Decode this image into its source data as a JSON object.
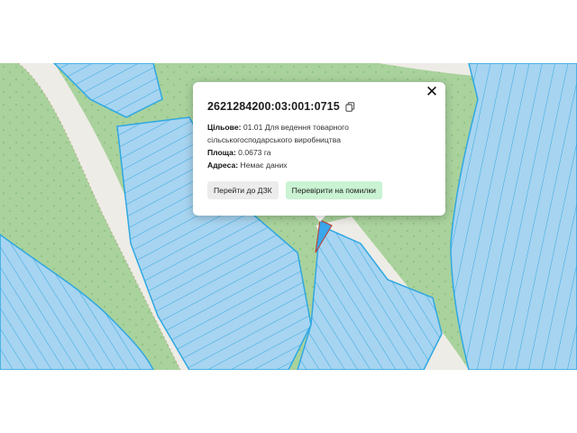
{
  "popup": {
    "parcel_number": "2621284200:03:001:0715",
    "purpose_label": "Цільове:",
    "purpose_value": "01.01 Для ведення товарного сільськогосподарського виробництва",
    "area_label": "Площа:",
    "area_value": "0.0673 га",
    "address_label": "Адреса:",
    "address_value": "Немає даних",
    "goto_button": "Перейти до ДЗК",
    "check_button": "Перевірити на помилки",
    "close_symbol": "✕"
  },
  "icons": {
    "copy": "copy-icon",
    "close": "close-icon"
  },
  "colors": {
    "forest": "#a9d29d",
    "parcel_fill": "#a7d4f0",
    "parcel_border": "#2fa8e3",
    "road": "#eeece6",
    "selected_parcel": "#3aa6ec",
    "check_button_bg": "#c9f3d2"
  }
}
